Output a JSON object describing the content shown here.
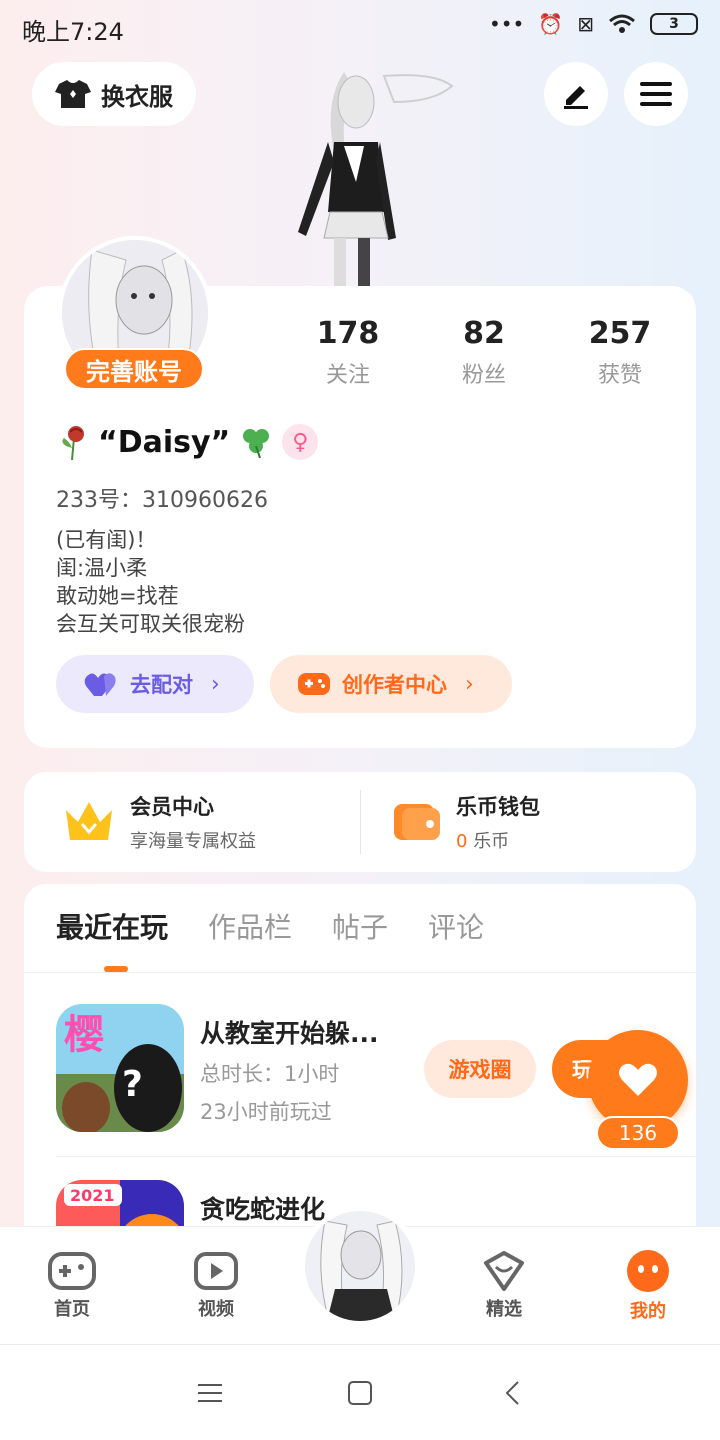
{
  "status_bar": {
    "time": "晚上7:24",
    "battery": "3"
  },
  "header": {
    "outfit_label": "换衣服"
  },
  "stats": [
    {
      "num": "178",
      "label": "关注"
    },
    {
      "num": "82",
      "label": "粉丝"
    },
    {
      "num": "257",
      "label": "获赞"
    }
  ],
  "profile": {
    "complete_label": "完善账号",
    "nickname": "“Daisy”",
    "gender_symbol": "♀",
    "uid": "233号：310960626",
    "bio": [
      "(已有闺)！",
      "闺:温小柔",
      "敢动她=找茬",
      "会互关可取关很宠粉"
    ],
    "match_label": "去配对",
    "creator_label": "创作者中心"
  },
  "vip": {
    "member_title": "会员中心",
    "member_sub": "享海量专属权益",
    "wallet_title": "乐币钱包",
    "wallet_amount": "0",
    "wallet_unit": "乐币"
  },
  "tabs": [
    "最近在玩",
    "作品栏",
    "帖子",
    "评论"
  ],
  "games": [
    {
      "title": "从教室开始躲...",
      "duration": "总时长：1小时",
      "last_played": "23小时前玩过",
      "circle_label": "游戏圈",
      "play_label": "玩"
    },
    {
      "title": "贪吃蛇进化",
      "year_badge": "2021"
    }
  ],
  "like": {
    "count": "136"
  },
  "bottom_nav": {
    "home": "首页",
    "video": "视频",
    "featured": "精选",
    "mine": "我的"
  },
  "colors": {
    "accent": "#ff7a1a",
    "purple": "#6a5ce4"
  }
}
